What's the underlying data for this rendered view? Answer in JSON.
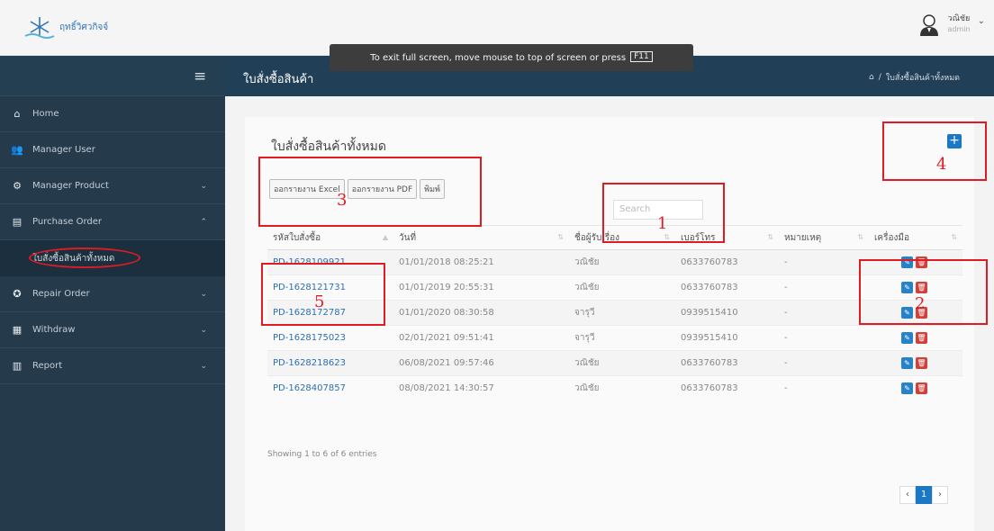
{
  "header": {
    "logo_text": "ฤทธิ์วิศวกิจจ์",
    "user_name": "วณิชัย",
    "user_role": "admin"
  },
  "fullscreen_banner": {
    "text": "To exit full screen, move mouse to top of screen or press",
    "key": "F11"
  },
  "sidebar": {
    "items": [
      {
        "label": "Home",
        "icon": "home-icon"
      },
      {
        "label": "Manager User",
        "icon": "users-icon"
      },
      {
        "label": "Manager Product",
        "icon": "gears-icon"
      },
      {
        "label": "Purchase Order",
        "icon": "list-icon"
      },
      {
        "label": "Repair Order",
        "icon": "wrench-icon"
      },
      {
        "label": "Withdraw",
        "icon": "file-icon"
      },
      {
        "label": "Report",
        "icon": "table-icon"
      }
    ],
    "sub_item": "ใบสั่งซื้อสินค้าทั้งหมด"
  },
  "content_header": {
    "title": "ใบสั่งซื้อสินค้า",
    "breadcrumb": "ใบสั่งซื้อสินค้าทั้งหมด"
  },
  "panel": {
    "title": "ใบสั่งซื้อสินค้าทั้งหมด",
    "buttons": [
      "ออกรายงาน Excel",
      "ออกรายงาน PDF",
      "พิมพ์"
    ],
    "search_placeholder": "Search",
    "columns": [
      "รหัสใบสั่งซื้อ",
      "วันที่",
      "ชื่อผู้รับเรื่อง",
      "เบอร์โทร",
      "หมายเหตุ",
      "เครื่องมือ"
    ],
    "rows": [
      [
        "PD-1628109921",
        "01/01/2018 08:25:21",
        "วณิชัย",
        "0633760783",
        "-"
      ],
      [
        "PD-1628121731",
        "01/01/2019 20:55:31",
        "วณิชัย",
        "0633760783",
        "-"
      ],
      [
        "PD-1628172787",
        "01/01/2020 08:30:58",
        "จารุวี",
        "0939515410",
        "-"
      ],
      [
        "PD-1628175023",
        "02/01/2021 09:51:41",
        "จารุวี",
        "0939515410",
        "-"
      ],
      [
        "PD-1628218623",
        "06/08/2021 09:57:46",
        "วณิชัย",
        "0633760783",
        "-"
      ],
      [
        "PD-1628407857",
        "08/08/2021 14:30:57",
        "วณิชัย",
        "0633760783",
        "-"
      ]
    ],
    "entries_text": "Showing 1 to 6 of 6 entries",
    "pager": {
      "prev": "‹",
      "current": "1",
      "next": "›"
    }
  },
  "annotations": [
    "1",
    "2",
    "3",
    "4",
    "5"
  ],
  "colors": {
    "sidebar": "#253b4c",
    "header": "#213f57",
    "accent": "#1b78c6",
    "annotation": "#e01b24"
  }
}
